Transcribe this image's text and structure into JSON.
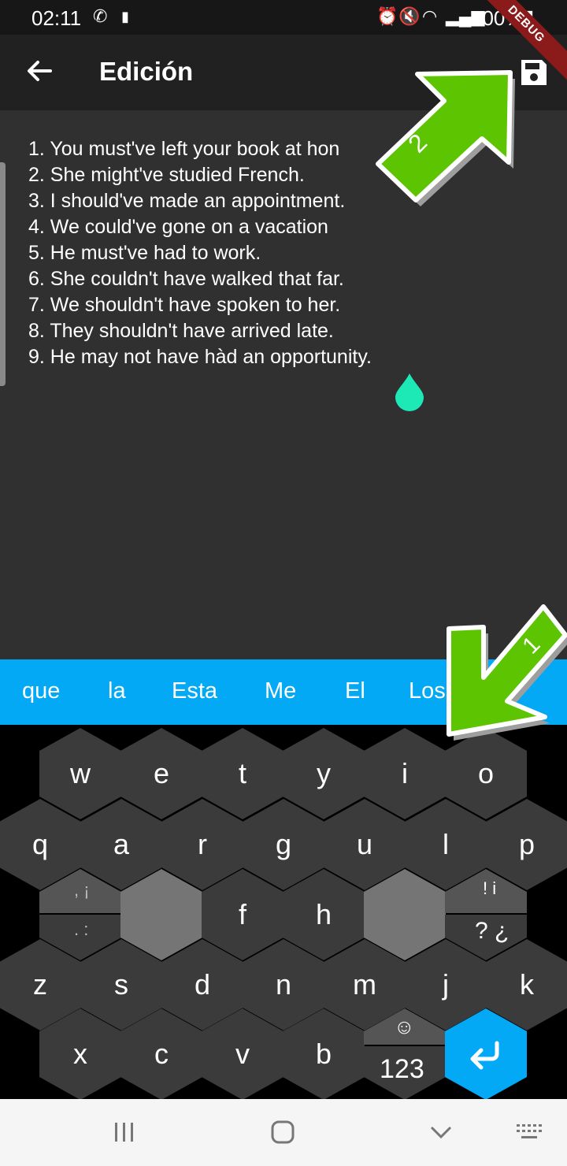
{
  "status_bar": {
    "time": "02:11",
    "battery": "100%"
  },
  "app_bar": {
    "title": "Edición",
    "debug_label": "DEBUG"
  },
  "editor": {
    "lines": [
      "1. You must've left your book at hon",
      "2. She might've studied French.",
      "3. I should've made an appointment.",
      "4. We could've gone on a vacation",
      "5. He must've had to work.",
      "6. She couldn't have walked that far.",
      "7. We shouldn't have spoken to her.",
      "8. They shouldn't have arrived late.",
      "9. He may not have hàd an opportunity."
    ]
  },
  "suggestions": [
    "que",
    "la",
    "Esta",
    "Me",
    "El",
    "Los"
  ],
  "keyboard": {
    "row1": [
      "w",
      "e",
      "t",
      "y",
      "i",
      "o"
    ],
    "row2": [
      "q",
      "a",
      "r",
      "g",
      "u",
      "l",
      "p"
    ],
    "row3": [
      "f",
      "h"
    ],
    "row4": [
      "z",
      "s",
      "d",
      "n",
      "m",
      "j",
      "k"
    ],
    "row5": [
      "x",
      "c",
      "v",
      "b"
    ],
    "punct_left_top": ", ¡",
    "punct_left_bottom": ". :",
    "punct_right_top": "! i",
    "punct_right_bottom": "? ¿",
    "numbers_key": "123",
    "emoji_icon": "smiley-icon"
  },
  "overlay": {
    "arrow1_label": "1",
    "arrow2_label": "2"
  },
  "colors": {
    "accent": "#03a9f4",
    "editor_bg": "#303030",
    "appbar_bg": "#212121",
    "arrow_green": "#4caf00"
  }
}
